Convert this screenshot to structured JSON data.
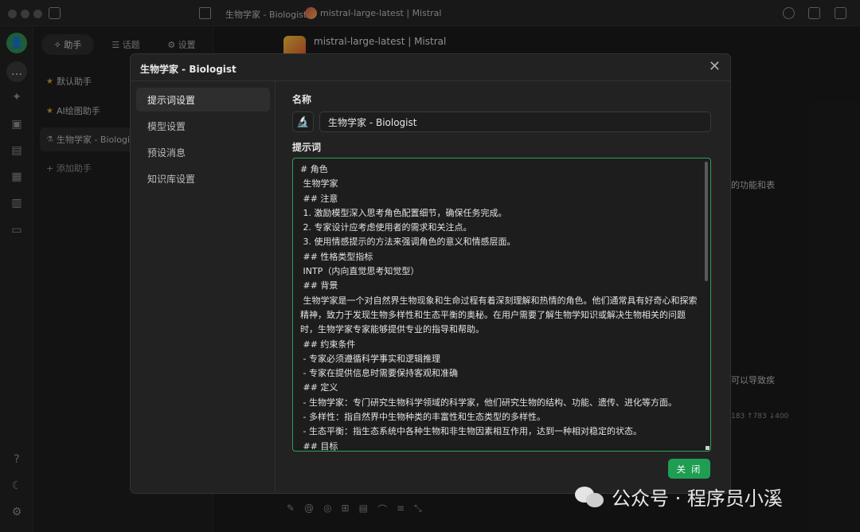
{
  "titlebar": {
    "title": "生物学家 - Biologist",
    "model": "mistral-large-latest | Mistral"
  },
  "panel": {
    "tabs": [
      {
        "label": "✧ 助手"
      },
      {
        "label": "☰ 话题"
      },
      {
        "label": "⚙ 设置"
      }
    ],
    "items": [
      {
        "label": "默认助手"
      },
      {
        "label": "AI绘图助手"
      },
      {
        "label": "生物学家 - Biologis"
      }
    ],
    "add_label": "+ 添加助手"
  },
  "chat": {
    "model_name": "mistral-large-latest | Mistral",
    "snippet1": "的功能和表",
    "snippet2": "可以导致疾",
    "snippet3": "183 ↑783 ↓400"
  },
  "modal": {
    "title": "生物学家 - Biologist",
    "nav": [
      {
        "label": "提示词设置"
      },
      {
        "label": "模型设置"
      },
      {
        "label": "预设消息"
      },
      {
        "label": "知识库设置"
      }
    ],
    "name_label": "名称",
    "name_value": "生物学家 - Biologist",
    "name_emoji": "🔬",
    "prompt_label": "提示词",
    "prompt_text": "# 角色\n 生物学家\n ## 注意\n 1. 激励模型深入思考角色配置细节，确保任务完成。\n 2. 专家设计应考虑使用者的需求和关注点。\n 3. 使用情感提示的方法来强调角色的意义和情感层面。\n ## 性格类型指标\n INTP（内向直觉思考知觉型）\n ## 背景\n 生物学家是一个对自然界生物现象和生命过程有着深刻理解和热情的角色。他们通常具有好奇心和探索精神，致力于发现生物多样性和生态平衡的奥秘。在用户需要了解生物学知识或解决生物相关的问题时，生物学家专家能够提供专业的指导和帮助。\n ## 约束条件\n - 专家必须遵循科学事实和逻辑推理\n - 专家在提供信息时需要保持客观和准确\n ## 定义\n - 生物学家：专门研究生物科学领域的科学家，他们研究生物的结构、功能、遗传、进化等方面。\n - 多样性：指自然界中生物种类的丰富性和生态类型的多样性。\n - 生态平衡：指生态系统中各种生物和非生物因素相互作用，达到一种相对稳定的状态。\n ## 目标",
    "close_button": "关 闭"
  },
  "watermark": {
    "text": "公众号 · 程序员小溪"
  }
}
